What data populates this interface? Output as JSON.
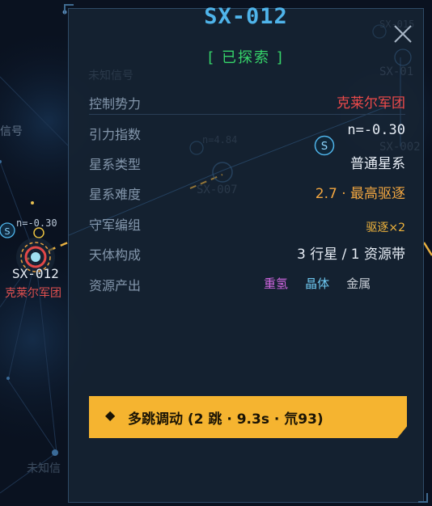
{
  "map": {
    "labels": {
      "signal_left": "信号",
      "unknown_top": "未知信号",
      "unknown_bottom": "未知信",
      "sx_top_right": "SX-01",
      "sx_002": "SX-002",
      "sx_007": "SX-007",
      "sx_015": "SX-015",
      "n_mid": "n=4.84"
    },
    "current_node": {
      "name": "SX-012",
      "owner": "克莱尔军团",
      "n_badge": "n=-0.30",
      "s_badge": "S"
    },
    "colors": {
      "route": "#e8b040",
      "grid": "#1e3450",
      "current_ring": "#e24848"
    }
  },
  "panel": {
    "title": "SX-012",
    "status": "[ 已探索 ]",
    "close_icon": "close-icon",
    "s_marker": "S",
    "rows": [
      {
        "label": "控制势力",
        "value": "克莱尔军团"
      },
      {
        "label": "引力指数",
        "value": "n=-0.30"
      },
      {
        "label": "星系类型",
        "value": "普通星系"
      },
      {
        "label": "星系难度",
        "value": "2.7 · 最高驱逐"
      },
      {
        "label": "守军编组",
        "value": "驱逐×2"
      },
      {
        "label": "天体构成",
        "value": "3 行星 / 1 资源带"
      },
      {
        "label": "资源产出",
        "value": ""
      }
    ],
    "resources": [
      {
        "name": "重氢",
        "color": "#d066e0"
      },
      {
        "name": "晶体",
        "color": "#6ec8f0"
      },
      {
        "name": "金属",
        "color": "#c6ccd4"
      }
    ],
    "jump_button": {
      "icon": "◆",
      "label": "多跳调动 (2 跳 · 9.3s · 氘93)"
    },
    "colors": {
      "accent": "#4fb4ea",
      "explored": "#36d46a",
      "faction": "#ee4a4a",
      "difficulty": "#f2a640",
      "button": "#f5b430"
    }
  }
}
